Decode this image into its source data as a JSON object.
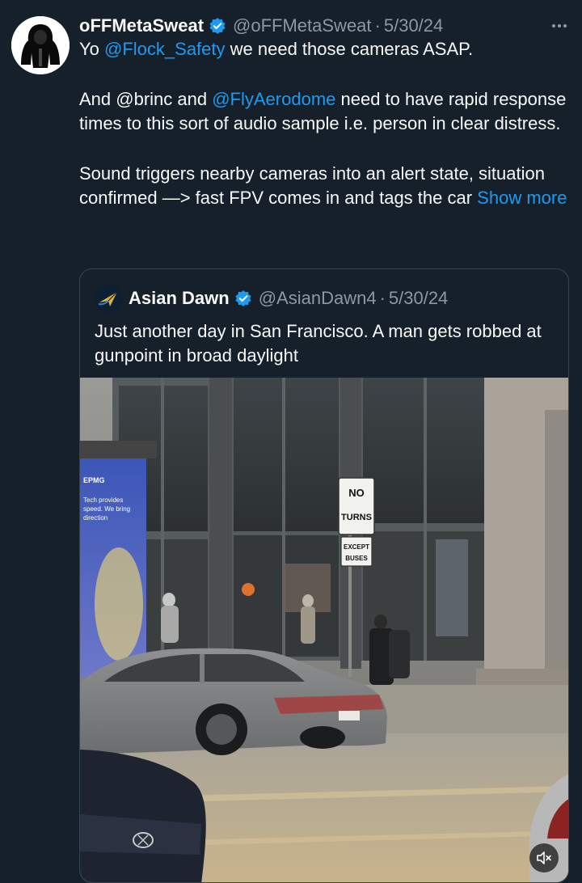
{
  "tweet": {
    "display_name": "oFFMetaSweat",
    "handle": "@oFFMetaSweat",
    "separator": "·",
    "date": "5/30/24",
    "avatar_icon": "hooded-figure-icon",
    "body": {
      "p1_prefix": "Yo ",
      "p1_mention": "@Flock_Safety",
      "p1_suffix": " we need those cameras ASAP.",
      "p2_prefix": "And @brinc and ",
      "p2_mention": "@FlyAerodome",
      "p2_suffix": " need to have rapid response times to this sort of audio sample i.e. person in clear distress.",
      "p3_text": "Sound triggers nearby cameras into an alert state, situation confirmed —> fast FPV comes in and tags the car ",
      "show_more": "Show more"
    }
  },
  "quote": {
    "display_name": "Asian Dawn",
    "handle": "@AsianDawn4",
    "separator": "·",
    "date": "5/30/24",
    "text": "Just another day in San Francisco. A man gets robbed at gunpoint in broad daylight",
    "media": {
      "sign_line1": "NO",
      "sign_line2": "TURNS",
      "sign_line3": "EXCEPT",
      "sign_line4": "BUSES",
      "kiosk_brand": "EPMG",
      "kiosk_line1": "Tech provides",
      "kiosk_line2": "speed. We bring",
      "kiosk_line3": "direction"
    }
  },
  "colors": {
    "background": "#15202b",
    "accent": "#1d9bf0",
    "secondary_text": "#8b98a5",
    "border": "#38444d"
  }
}
